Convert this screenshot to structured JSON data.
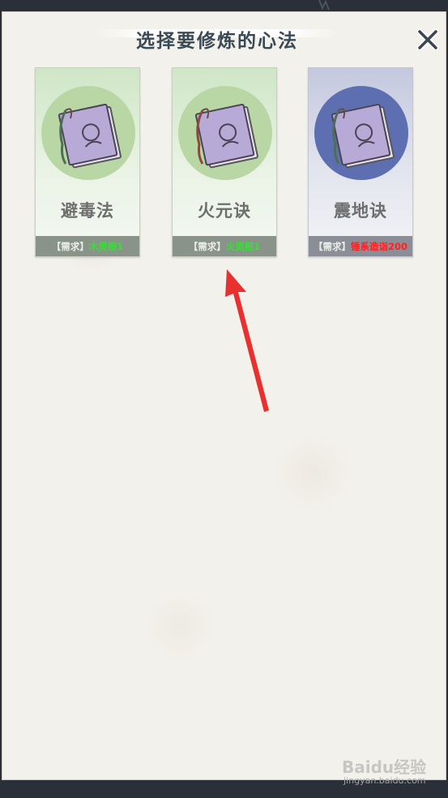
{
  "dialog": {
    "title": "选择要修炼的心法"
  },
  "cards": [
    {
      "name": "避毒法",
      "req_tag": "【需求】",
      "req_value": "木灵根1",
      "req_met": true,
      "theme": "green"
    },
    {
      "name": "火元诀",
      "req_tag": "【需求】",
      "req_value": "火灵根1",
      "req_met": true,
      "theme": "green"
    },
    {
      "name": "震地诀",
      "req_tag": "【需求】",
      "req_value": "锤系造诣200",
      "req_met": false,
      "theme": "blue"
    }
  ],
  "icons": {
    "close": "close-icon",
    "book": "book-icon",
    "arrow": "arrow-annotation"
  },
  "colors": {
    "req_met": "#2ee62e",
    "req_unmet": "#ff2020",
    "card_green": "#cfe6c6",
    "card_blue": "#c3c8de",
    "arrow": "#e8302f"
  },
  "watermark": {
    "logo": "Baidu经验",
    "url": "jingyan.baidu.com"
  }
}
